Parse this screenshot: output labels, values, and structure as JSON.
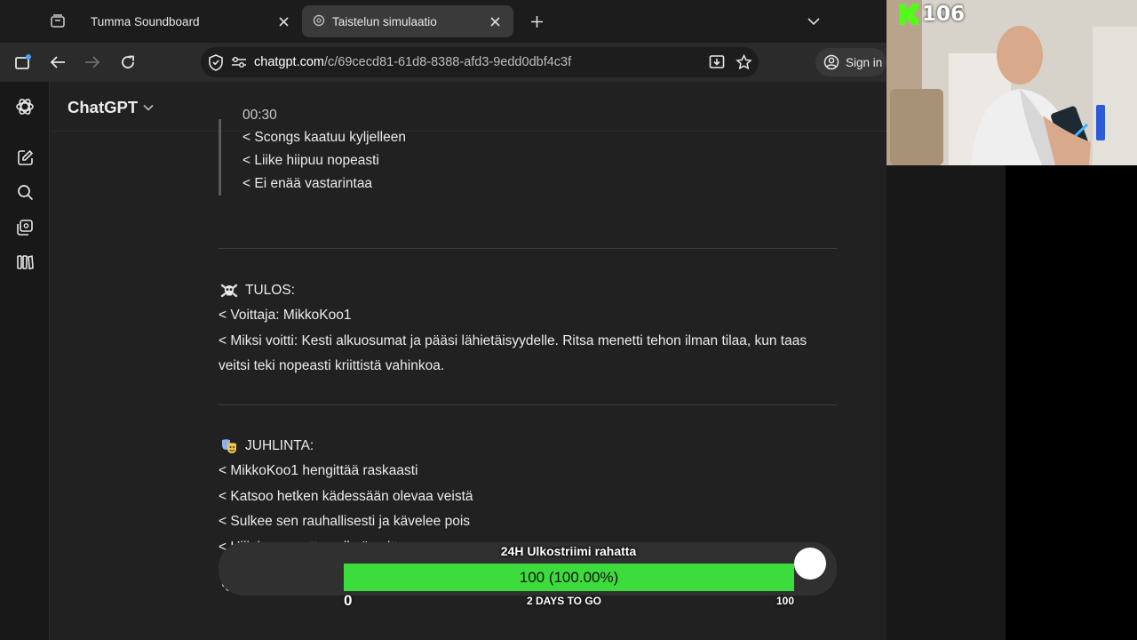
{
  "browser": {
    "tabs": [
      {
        "title": "Tumma Soundboard",
        "active": false
      },
      {
        "title": "Taistelun simulaatio",
        "active": true
      }
    ],
    "url_host": "chatgpt.com",
    "url_path": "/c/69cecd81-61d8-8388-afd3-9edd0dbf4c3f",
    "signin_label": "Sign in"
  },
  "app": {
    "model_name": "ChatGPT",
    "sidebar_icons": [
      "chatgpt-logo",
      "new-chat-icon",
      "search-icon",
      "library-icon",
      "codex-icon"
    ]
  },
  "message": {
    "quote_cut": "00:30",
    "quote_lines": [
      "< Scongs kaatuu kyljelleen",
      "< Liike hiipuu nopeasti",
      "< Ei enää vastarintaa"
    ],
    "result_heading": "TULOS:",
    "result_lines": [
      "< Voittaja: MikkoKoo1",
      "< Miksi voitti: Kesti alkuosumat ja pääsi lähietäisyydelle. Ritsa menetti tehon ilman tilaa, kun taas veitsi teki nopeasti kriittistä vahinkoa."
    ],
    "celebration_heading": "JUHLINTA:",
    "celebration_lines": [
      "< MikkoKoo1 hengittää raskaasti",
      "< Katsoo hetken kädessään olevaa veistä",
      "< Sulkee sen rauhallisesti ja kävelee pois",
      "< Hiljainen, mutta selkeä voitto."
    ],
    "action_icons": [
      "copy-icon",
      "thumbs-up-icon",
      "thumbs-down-icon",
      "share-icon"
    ]
  },
  "overlay": {
    "goal_title": "24H Ulkostriimi rahatta",
    "goal_text": "100 (100.00%)",
    "goal_fraction": 1.0,
    "goal_min": "0",
    "goal_deadline": "2 DAYS TO GO",
    "goal_max": "100",
    "viewer_count": "106",
    "accent_color": "#3ddc3d",
    "kick_color": "#53fc18"
  }
}
